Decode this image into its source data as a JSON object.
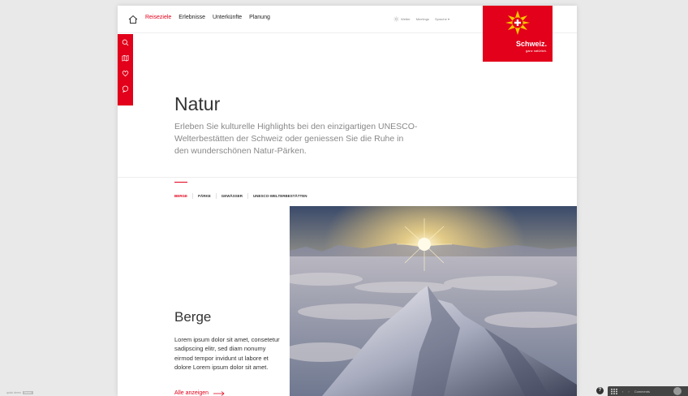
{
  "header": {
    "nav": [
      "Reiseziele",
      "Erlebnisse",
      "Unterkünfte",
      "Planung"
    ],
    "active_nav": "Reiseziele",
    "utilities": {
      "weather": "Wetter",
      "meetings": "Meetings",
      "language": "Sprache"
    }
  },
  "logo": {
    "brand": "Schweiz.",
    "tagline": "ganz natürlich."
  },
  "hero": {
    "title": "Natur",
    "intro": "Erleben Sie kulturelle Highlights bei den einzigartigen UNESCO-Welterbestätten der Schweiz oder geniessen Sie die Ruhe in den wunderschönen Natur-Pärken."
  },
  "tabs": [
    "BERGE",
    "PÄRKE",
    "GEWÄSSER",
    "UNESCO-WELTERBESTÄTTEN"
  ],
  "section": {
    "title": "Berge",
    "text": "Lorem ipsum dolor sit amet, consetetur sadipscing elitr, sed diam nonumy eirmod tempor invidunt ut labore et dolore Lorem ipsum dolor sit amet.",
    "link": "Alle anzeigen"
  },
  "footer": {
    "left_text": "quick demo",
    "left_badge": "beam",
    "help": "?",
    "toolbar_label": "Comments"
  },
  "colors": {
    "accent": "#e2001a"
  },
  "icons": [
    "home-icon",
    "search-icon",
    "map-icon",
    "heart-icon",
    "chat-icon",
    "sun-icon",
    "arrow-right-icon"
  ]
}
